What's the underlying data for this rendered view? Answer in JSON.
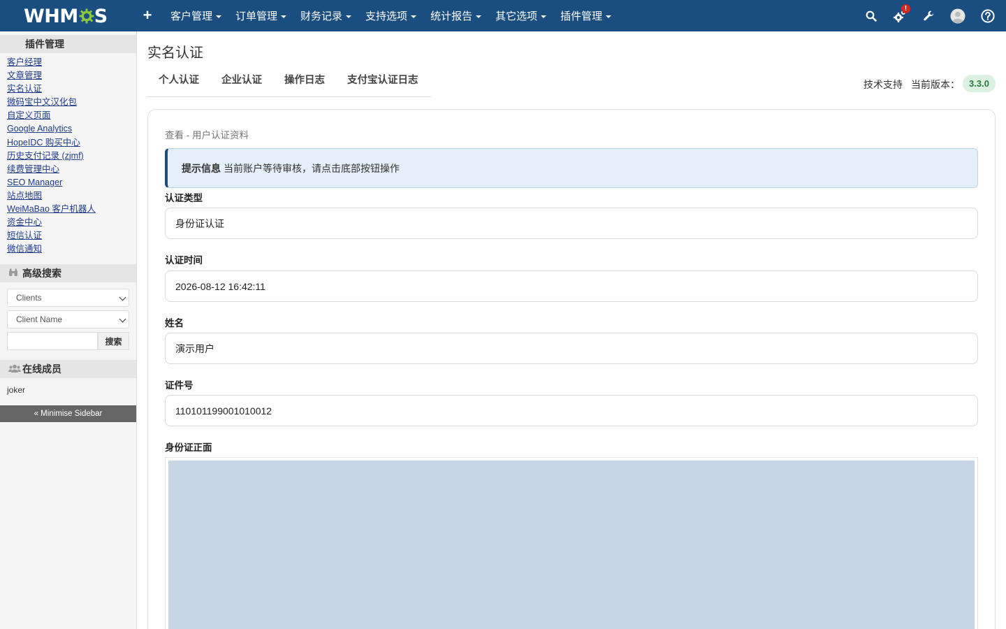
{
  "topnav": {
    "logo_left": "WHM",
    "logo_right": "S",
    "add_icon": "plus-icon",
    "menu": [
      {
        "label": "客户管理"
      },
      {
        "label": "订单管理"
      },
      {
        "label": "财务记录"
      },
      {
        "label": "支持选项"
      },
      {
        "label": "统计报告"
      },
      {
        "label": "其它选项"
      },
      {
        "label": "插件管理"
      }
    ],
    "right_icons": [
      "search-icon",
      "gear-icon",
      "wrench-icon",
      "avatar-icon",
      "help-icon"
    ],
    "alert_badge": "!"
  },
  "sidebar": {
    "addons_title": "插件管理",
    "addons": [
      "客户经理",
      "文章管理",
      "实名认证",
      "微码宝中文汉化包",
      "自定义页面",
      "Google Analytics",
      "HopeIDC 购买中心",
      "历史支付记录 (zjmf)",
      "续费管理中心",
      "SEO Manager",
      "站点地图",
      "WeiMaBao 客户机器人",
      "资金中心",
      "短信认证",
      "微信通知"
    ],
    "search_title": "高级搜索",
    "search_type": "Clients",
    "search_field": "Client Name",
    "search_input": "",
    "search_button": "搜索",
    "online_title": "在线成员",
    "online_users": [
      "joker"
    ],
    "minimise": "« Minimise Sidebar"
  },
  "main": {
    "title": "实名认证",
    "tabs": [
      "个人认证",
      "企业认证",
      "操作日志",
      "支付宝认证日志"
    ],
    "support_link": "技术支持",
    "version_label": "当前版本：",
    "version": "3.3.0",
    "subtitle": "查看 - 用户认证资料",
    "alert_title": "提示信息",
    "alert_text": "当前账户等待审核，请点击底部按钮操作",
    "fields": [
      {
        "label": "认证类型",
        "value": "身份证认证"
      },
      {
        "label": "认证时间",
        "value": "2026-08-12 16:42:11"
      },
      {
        "label": "姓名",
        "value": "演示用户"
      },
      {
        "label": "证件号",
        "value": "110101199001010012"
      }
    ],
    "id_front_label": "身份证正面"
  },
  "colors": {
    "navbar": "#1a4d80",
    "logo_gear": "#8ac640",
    "alert_bg": "#e4eff9",
    "version_pill_bg": "#dcf1e1",
    "version_pill_text": "#2b7a3f",
    "image_placeholder": "#c8d5e4"
  }
}
